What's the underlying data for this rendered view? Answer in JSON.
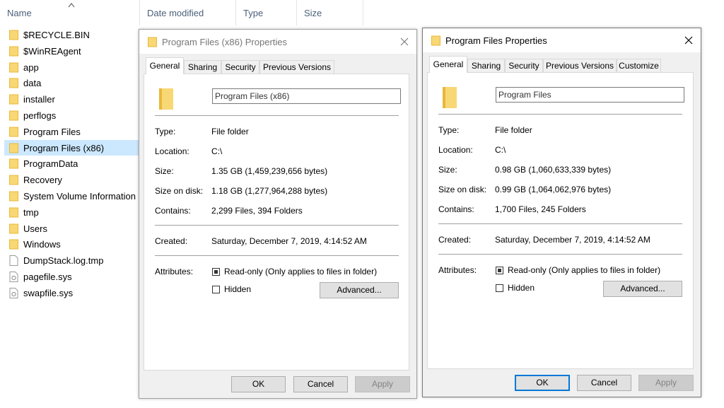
{
  "explorer": {
    "columns": {
      "name": "Name",
      "date_modified": "Date modified",
      "type": "Type",
      "size": "Size"
    },
    "files": [
      {
        "name": "$RECYCLE.BIN",
        "icon": "folder-icon"
      },
      {
        "name": "$WinREAgent",
        "icon": "folder-icon"
      },
      {
        "name": "app",
        "icon": "folder-icon"
      },
      {
        "name": "data",
        "icon": "folder-icon"
      },
      {
        "name": "installer",
        "icon": "folder-icon"
      },
      {
        "name": "perflogs",
        "icon": "folder-icon"
      },
      {
        "name": "Program Files",
        "icon": "folder-icon"
      },
      {
        "name": "Program Files (x86)",
        "icon": "folder-icon",
        "selected": true
      },
      {
        "name": "ProgramData",
        "icon": "folder-icon"
      },
      {
        "name": "Recovery",
        "icon": "folder-icon"
      },
      {
        "name": "System Volume Information",
        "icon": "folder-icon"
      },
      {
        "name": "tmp",
        "icon": "folder-icon"
      },
      {
        "name": "Users",
        "icon": "folder-icon"
      },
      {
        "name": "Windows",
        "icon": "folder-icon"
      },
      {
        "name": "DumpStack.log.tmp",
        "icon": "file-icon"
      },
      {
        "name": "pagefile.sys",
        "icon": "system-file-icon"
      },
      {
        "name": "swapfile.sys",
        "icon": "system-file-icon"
      }
    ]
  },
  "dialog_x86": {
    "title": "Program Files (x86) Properties",
    "tabs": [
      "General",
      "Sharing",
      "Security",
      "Previous Versions"
    ],
    "name_value": "Program Files (x86)",
    "labels": {
      "type": "Type:",
      "location": "Location:",
      "size": "Size:",
      "size_on_disk": "Size on disk:",
      "contains": "Contains:",
      "created": "Created:",
      "attributes": "Attributes:"
    },
    "values": {
      "type": "File folder",
      "location": "C:\\",
      "size": "1.35 GB (1,459,239,656 bytes)",
      "size_on_disk": "1.18 GB (1,277,964,288 bytes)",
      "contains": "2,299 Files, 394 Folders",
      "created": "Saturday, December 7, 2019, 4:14:52 AM"
    },
    "readonly_label": "Read-only (Only applies to files in folder)",
    "hidden_label": "Hidden",
    "advanced_label": "Advanced...",
    "ok_label": "OK",
    "cancel_label": "Cancel",
    "apply_label": "Apply"
  },
  "dialog_pf": {
    "title": "Program Files Properties",
    "tabs": [
      "General",
      "Sharing",
      "Security",
      "Previous Versions",
      "Customize"
    ],
    "name_value": "Program Files",
    "labels": {
      "type": "Type:",
      "location": "Location:",
      "size": "Size:",
      "size_on_disk": "Size on disk:",
      "contains": "Contains:",
      "created": "Created:",
      "attributes": "Attributes:"
    },
    "values": {
      "type": "File folder",
      "location": "C:\\",
      "size": "0.98 GB (1,060,633,339 bytes)",
      "size_on_disk": "0.99 GB (1,064,062,976 bytes)",
      "contains": "1,700 Files, 245 Folders",
      "created": "Saturday, December 7, 2019, 4:14:52 AM"
    },
    "readonly_label": "Read-only (Only applies to files in folder)",
    "hidden_label": "Hidden",
    "advanced_label": "Advanced...",
    "ok_label": "OK",
    "cancel_label": "Cancel",
    "apply_label": "Apply"
  },
  "colors": {
    "folder": "#f8d775",
    "folder_dark": "#e8b83a",
    "selection": "#cce8ff",
    "accent": "#0078d7"
  }
}
